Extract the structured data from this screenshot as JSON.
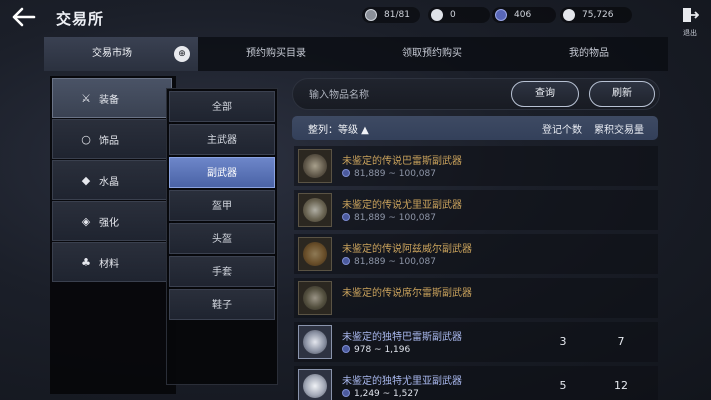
{
  "header": {
    "title": "交易所",
    "resources": [
      {
        "icon": "energy-icon",
        "value": "81/81"
      },
      {
        "icon": "silver-coin-icon",
        "value": "0"
      },
      {
        "icon": "blue-diamond-icon",
        "value": "406"
      },
      {
        "icon": "gold-coin-icon",
        "value": "75,726"
      }
    ],
    "exit_label": "退出"
  },
  "tabs": [
    {
      "label": "交易市场",
      "active": true
    },
    {
      "label": "预约购买目录",
      "active": false
    },
    {
      "label": "领取预约购买",
      "active": false
    },
    {
      "label": "我的物品",
      "active": false
    }
  ],
  "categories": [
    {
      "label": "装备",
      "icon": "crossed-swords-icon",
      "active": true
    },
    {
      "label": "饰品",
      "icon": "ring-icon",
      "active": false
    },
    {
      "label": "水晶",
      "icon": "gem-icon",
      "active": false
    },
    {
      "label": "强化",
      "icon": "enhance-icon",
      "active": false
    },
    {
      "label": "材料",
      "icon": "potion-icon",
      "active": false
    }
  ],
  "subcategories": [
    {
      "label": "全部",
      "active": false
    },
    {
      "label": "主武器",
      "active": false
    },
    {
      "label": "副武器",
      "active": true
    },
    {
      "label": "盔甲",
      "active": false
    },
    {
      "label": "头盔",
      "active": false
    },
    {
      "label": "手套",
      "active": false
    },
    {
      "label": "鞋子",
      "active": false
    }
  ],
  "search": {
    "placeholder": "输入物品名称",
    "search_label": "查询",
    "refresh_label": "刷新"
  },
  "list_header": {
    "sort_label": "整列：等级 ▲",
    "col_listed": "登记个数",
    "col_traded": "累积交易量"
  },
  "items": [
    {
      "name": "未鉴定的传说巴雷斯副武器",
      "price": "81,889 ~ 100,087",
      "listed": "",
      "traded": "",
      "rarity": "legendary"
    },
    {
      "name": "未鉴定的传说尤里亚副武器",
      "price": "81,889 ~ 100,087",
      "listed": "",
      "traded": "",
      "rarity": "legendary"
    },
    {
      "name": "未鉴定的传说阿兹威尔副武器",
      "price": "81,889 ~ 100,087",
      "listed": "",
      "traded": "",
      "rarity": "legendary"
    },
    {
      "name": "未鉴定的传说席尔雷斯副武器",
      "price": "",
      "listed": "",
      "traded": "",
      "rarity": "legendary"
    },
    {
      "name": "未鉴定的独特巴雷斯副武器",
      "price": "978 ~ 1,196",
      "listed": "3",
      "traded": "7",
      "rarity": "unique"
    },
    {
      "name": "未鉴定的独特尤里亚副武器",
      "price": "1,249 ~ 1,527",
      "listed": "5",
      "traded": "12",
      "rarity": "unique"
    }
  ],
  "colors": {
    "legendary_name": "#c9a25c",
    "unique_name": "#a9b8ee",
    "active_subcategory": "#5a73b8"
  }
}
